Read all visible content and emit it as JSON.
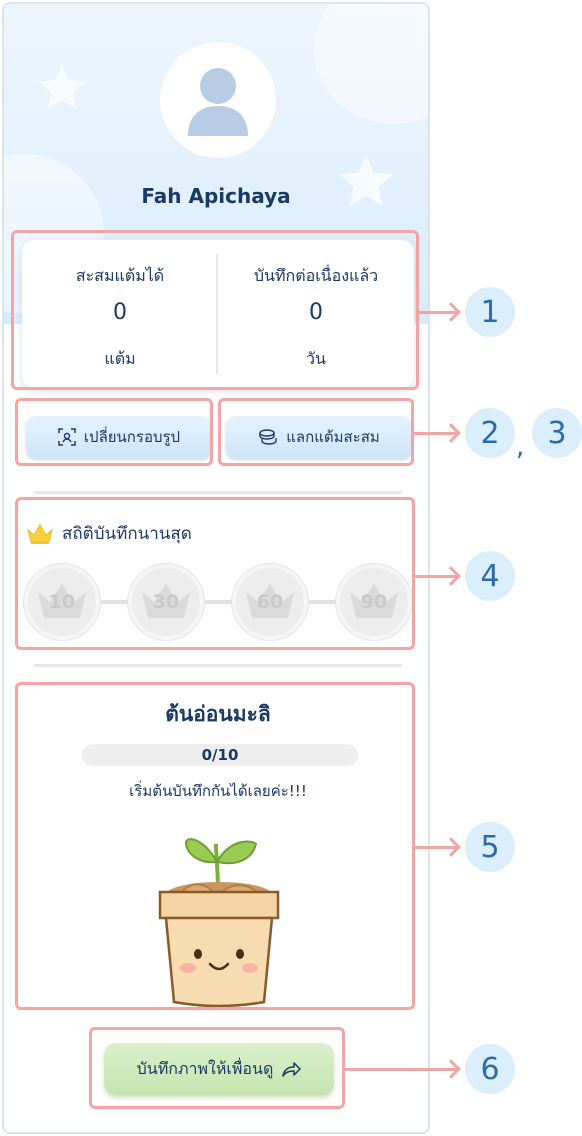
{
  "profile": {
    "name": "Fah Apichaya"
  },
  "stats": {
    "points": {
      "label": "สะสมแต้มได้",
      "value": "0",
      "unit": "แต้ม"
    },
    "streak": {
      "label": "บันทึกต่อเนื่องแล้ว",
      "value": "0",
      "unit": "วัน"
    }
  },
  "actions": {
    "change_frame": "เปลี่ยนกรอบรูป",
    "redeem_points": "แลกแต้มสะสม"
  },
  "records": {
    "title": "สถิติบันทึกนานสุด",
    "badges": [
      "10",
      "30",
      "60",
      "90"
    ]
  },
  "plant": {
    "title": "ต้นอ่อนมะลิ",
    "progress_text": "0/10",
    "progress_value": 0,
    "message": "เริ่มต้นบันทึกกันได้เลยค่ะ!!!"
  },
  "share": {
    "label": "บันทึกภาพให้เพื่อนดู"
  },
  "callouts": [
    "1",
    "2",
    "3",
    "4",
    "5",
    "6"
  ],
  "colors": {
    "accent": "#1b3a66",
    "highlight": "#f3a5a5",
    "callout_bg": "#dbeefc",
    "share_bg": "#c4e4ae"
  },
  "icons": [
    "user-avatar-icon",
    "frame-scan-icon",
    "coins-icon",
    "crown-icon",
    "share-arrow-icon"
  ]
}
